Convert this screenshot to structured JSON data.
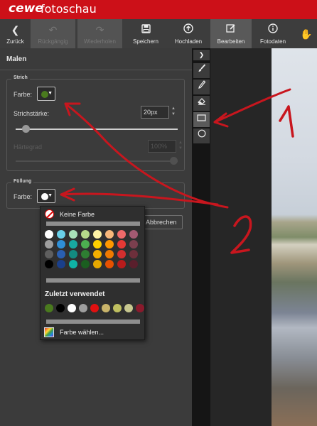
{
  "app": {
    "brand": "cewe",
    "title": "fotoschau"
  },
  "toolbar": {
    "back": "Zurück",
    "undo": "Rückgängig",
    "redo": "Wiederholen",
    "save": "Speichern",
    "upload": "Hochladen",
    "edit": "Bearbeiten",
    "photodata": "Fotodaten"
  },
  "panel": {
    "title": "Malen",
    "stroke": {
      "section": "Strich",
      "color_label": "Farbe:",
      "color": "#4a7a1e",
      "width_label": "Strichstärke:",
      "width_value": "20px",
      "width_level": 0.04,
      "hardness_label": "Härtegrad",
      "hardness_value": "100%",
      "hardness_level": 1.0
    },
    "fill": {
      "section": "Füllung",
      "color_label": "Farbe:",
      "color": "#ffffff"
    },
    "cancel": "Abbrechen"
  },
  "color_popup": {
    "no_color": "Keine Farbe",
    "palette": [
      "#ffffff",
      "#6ad0e8",
      "#a8e0b8",
      "#b6d98a",
      "#fff3a6",
      "#f7b77a",
      "#ef6a6a",
      "#a35a72",
      "#f07fbf",
      "#9e9e9e",
      "#2f8fd6",
      "#18a8a0",
      "#4caf50",
      "#ffd000",
      "#ff9800",
      "#e53935",
      "#7b3f4e",
      "#d81b60",
      "#5f5f5f",
      "#2a5fb0",
      "#138a80",
      "#2e7d32",
      "#f4b000",
      "#ef7a00",
      "#d32f2f",
      "#6d2f3b",
      "#ad1457",
      "#000000",
      "#1a3f8a",
      "#0fb3a5",
      "#1b5e20",
      "#e6a800",
      "#e65100",
      "#b71c1c",
      "#5a1f2c",
      "#880e4f"
    ],
    "recent_title": "Zuletzt verwendet",
    "recent": [
      "#4a7a1e",
      "#000000",
      "#ffffff",
      "#9e9e9e",
      "#e01010",
      "#c9b46a",
      "#bfbf60",
      "#c7c78f",
      "#8a1a2c"
    ],
    "choose": "Farbe wählen..."
  },
  "annotations": {
    "label1": "1",
    "label2": "2",
    "color": "#c8161e"
  },
  "tools": [
    "expand-icon",
    "brush-icon",
    "pencil-icon",
    "eraser-icon",
    "rectangle-icon",
    "ellipse-icon"
  ]
}
